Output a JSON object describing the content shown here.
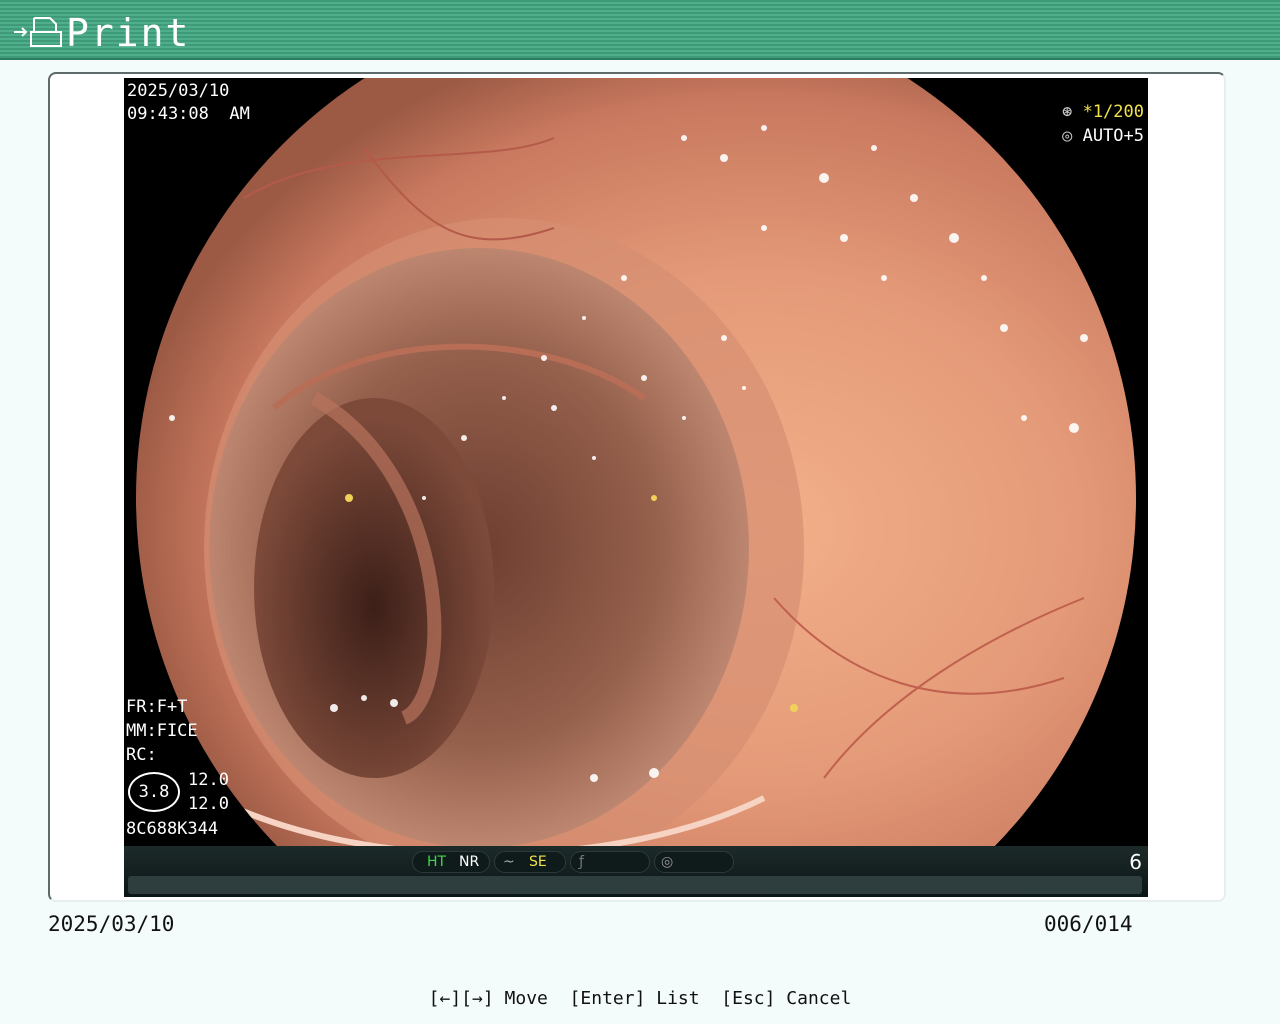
{
  "header": {
    "title": "Print",
    "icon": "print-icon"
  },
  "image": {
    "date": "2025/03/10",
    "time": "09:43:08  AM",
    "shutter_symbol": "*",
    "shutter": "1/200",
    "auto": "AUTO+5",
    "fr": "FR:F+T",
    "mm": "MM:FICE",
    "rc": "RC:",
    "zoom": "3.8",
    "value_top": "12.0",
    "value_bottom": "12.0",
    "serial": "8C688K344",
    "status": {
      "ht": "HT",
      "nr": "NR",
      "se": "SE"
    },
    "frame_number": "6",
    "colors": {
      "highlight_green": "#42d64a",
      "highlight_yellow": "#f1e24a"
    }
  },
  "footer": {
    "date": "2025/03/10",
    "count": "006/014",
    "hints": "[←][→] Move  [Enter] List  [Esc] Cancel"
  }
}
